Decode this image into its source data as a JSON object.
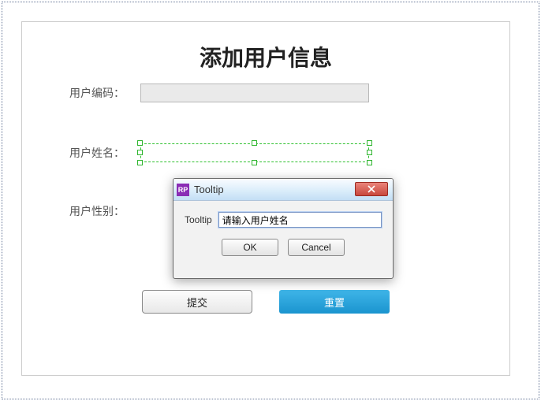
{
  "form": {
    "title": "添加用户信息",
    "fields": {
      "code": {
        "label": "用户编码：",
        "value": ""
      },
      "name": {
        "label": "用户姓名：",
        "value": ""
      },
      "gender": {
        "label": "用户性别：",
        "value": ""
      }
    },
    "buttons": {
      "submit": "提交",
      "reset": "重置"
    }
  },
  "dialog": {
    "app_icon_text": "RP",
    "title": "Tooltip",
    "field_label": "Tooltip",
    "field_value": "请输入用户姓名",
    "ok": "OK",
    "cancel": "Cancel"
  }
}
